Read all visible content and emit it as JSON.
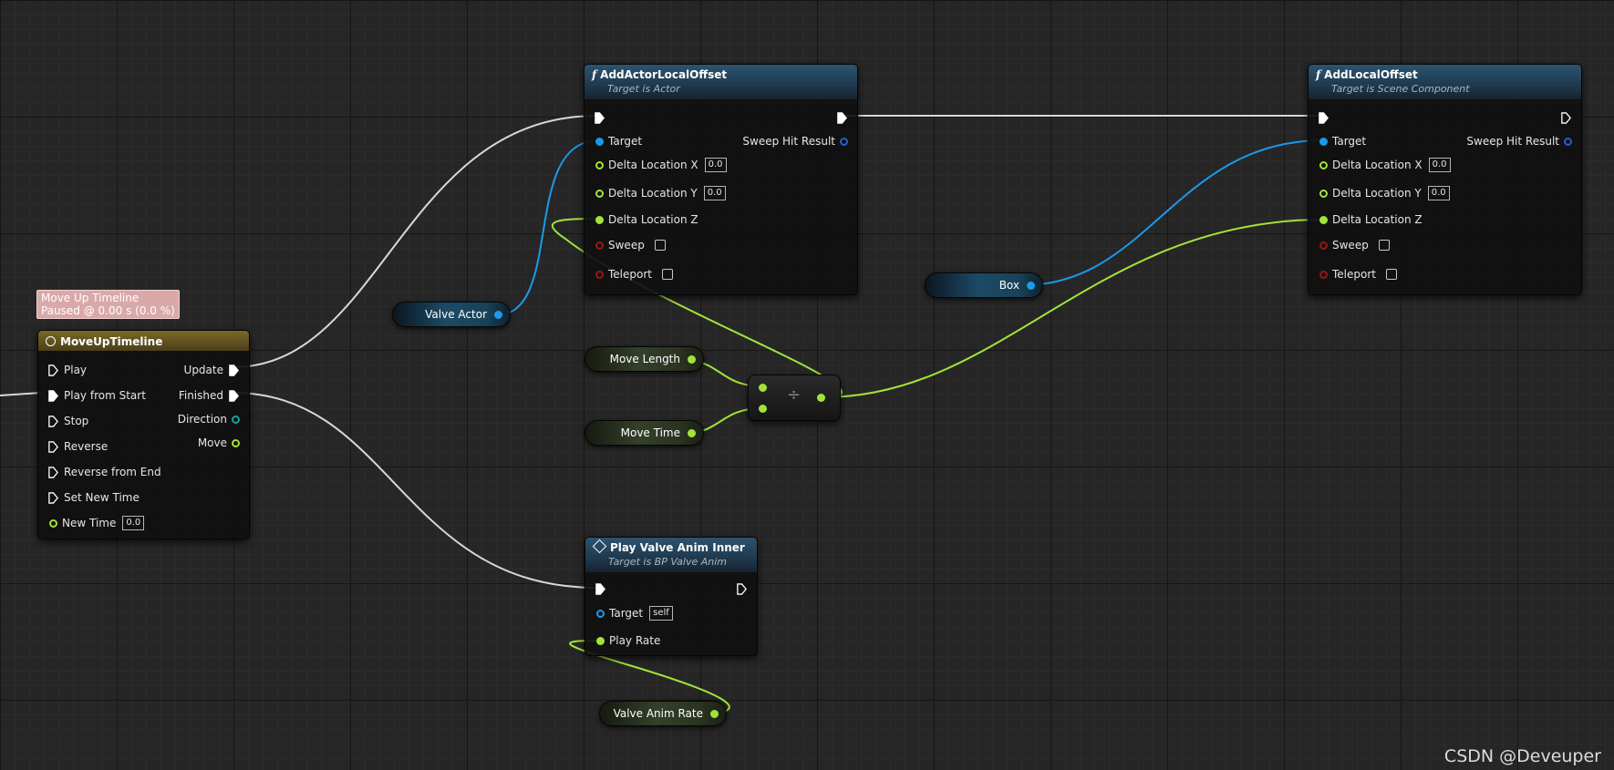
{
  "timeline_tooltip": {
    "line1": "Move Up Timeline",
    "line2": "Paused @ 0.00 s (0.0 %)"
  },
  "timeline_node": {
    "title": "MoveUpTimeline",
    "inputs": [
      "Play",
      "Play from Start",
      "Stop",
      "Reverse",
      "Reverse from End",
      "Set New Time"
    ],
    "new_time_label": "New Time",
    "new_time_value": "0.0",
    "outputs": [
      "Update",
      "Finished",
      "Direction",
      "Move"
    ]
  },
  "add_actor_local_offset": {
    "title": "AddActorLocalOffset",
    "subtitle": "Target is Actor",
    "target_label": "Target",
    "sweep_hit_label": "Sweep Hit Result",
    "delta_x_label": "Delta Location X",
    "delta_x_value": "0.0",
    "delta_y_label": "Delta Location Y",
    "delta_y_value": "0.0",
    "delta_z_label": "Delta Location Z",
    "sweep_label": "Sweep",
    "teleport_label": "Teleport"
  },
  "add_local_offset": {
    "title": "AddLocalOffset",
    "subtitle": "Target is Scene Component",
    "target_label": "Target",
    "sweep_hit_label": "Sweep Hit Result",
    "delta_x_label": "Delta Location X",
    "delta_x_value": "0.0",
    "delta_y_label": "Delta Location Y",
    "delta_y_value": "0.0",
    "delta_z_label": "Delta Location Z",
    "sweep_label": "Sweep",
    "teleport_label": "Teleport"
  },
  "play_valve_anim": {
    "title": "Play Valve Anim Inner",
    "subtitle": "Target is BP Valve Anim",
    "target_label": "Target",
    "target_value": "self",
    "play_rate_label": "Play Rate"
  },
  "variables": {
    "valve_actor": "Valve Actor",
    "box": "Box",
    "move_length": "Move Length",
    "move_time": "Move Time",
    "valve_anim_rate": "Valve Anim Rate"
  },
  "divide_symbol": "÷",
  "watermark": "CSDN @Deveuper",
  "colors": {
    "exec_wire": "#e0e0e0",
    "object_pin": "#1a9ae8",
    "float_pin": "#a2e33a",
    "bool_pin": "#9a1616",
    "timeline_header": "#7b6728",
    "function_header": "#2c5470"
  }
}
